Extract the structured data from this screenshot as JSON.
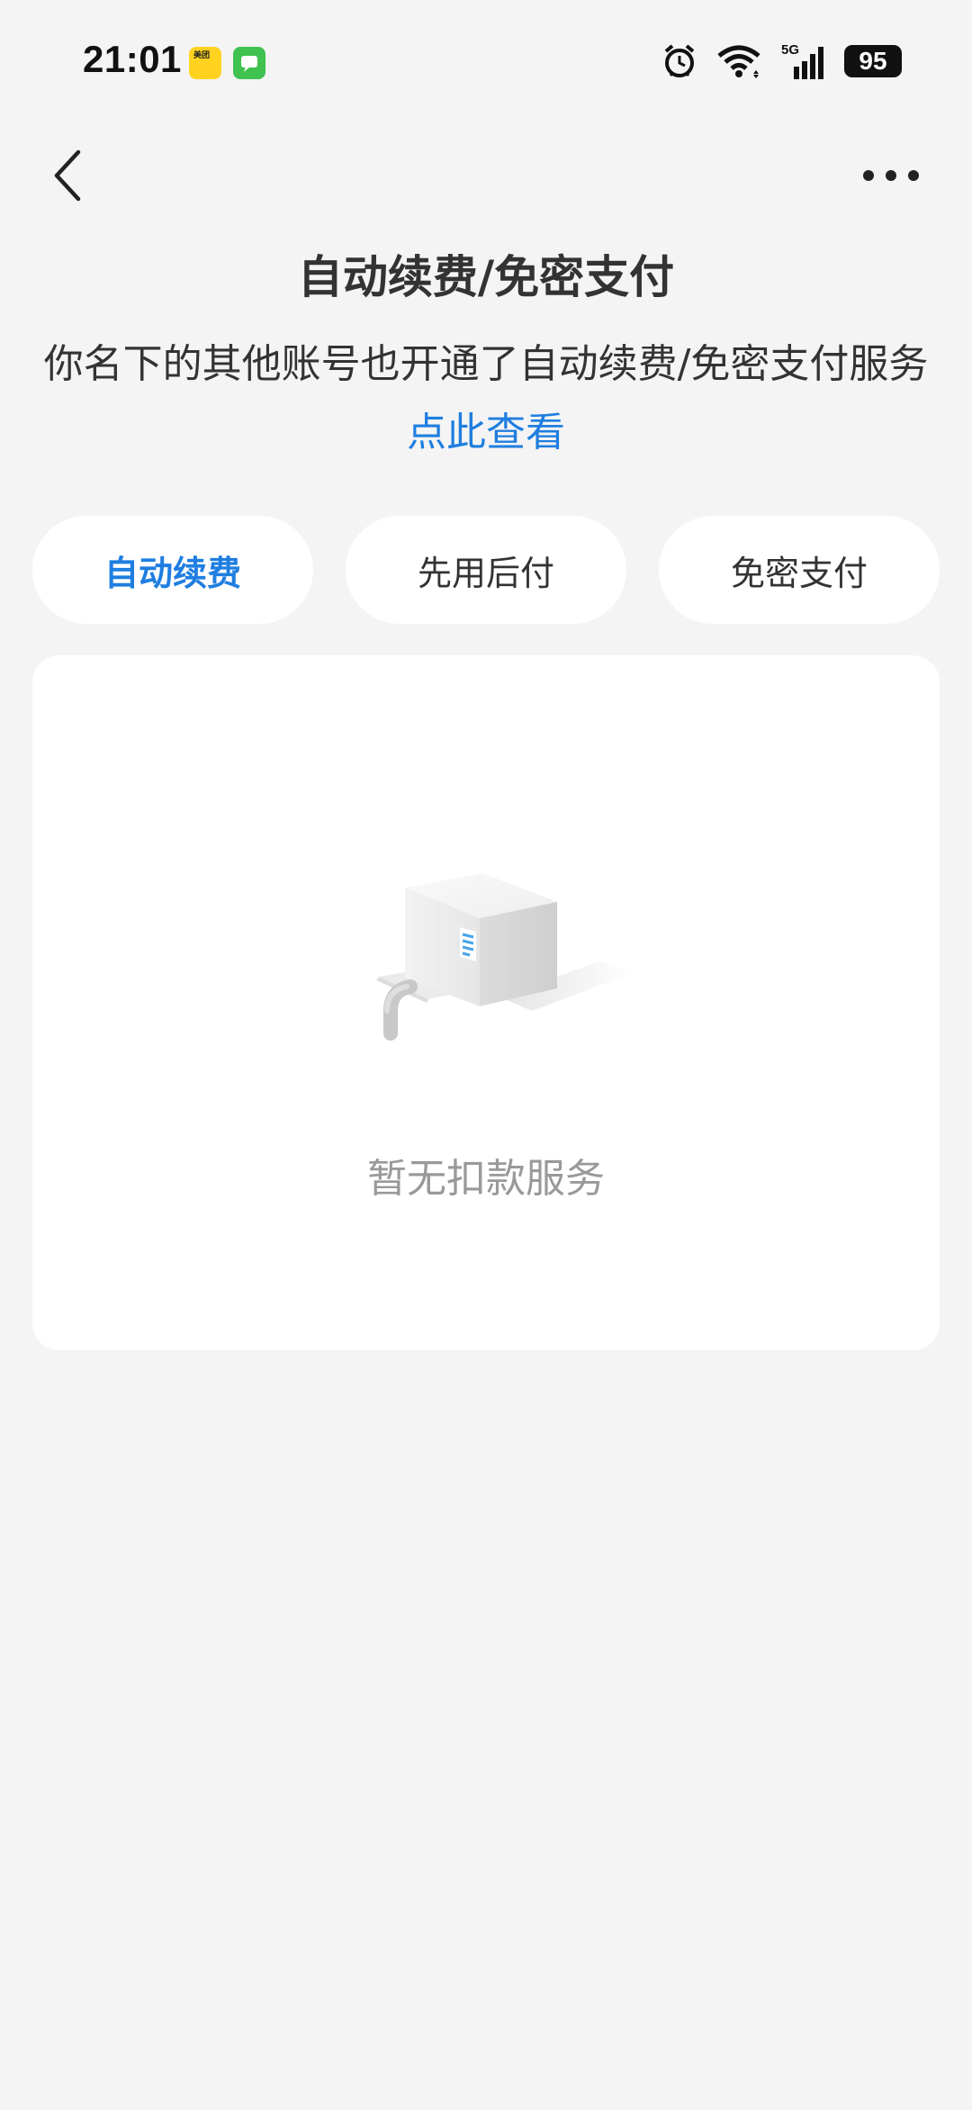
{
  "status_bar": {
    "time": "21:01",
    "meituan_icon_text": "美团",
    "network": "5G",
    "battery": "95"
  },
  "nav": {
    "back_icon": "chevron-left-icon",
    "more_icon": "more-dots-icon"
  },
  "page": {
    "title": "自动续费/免密支付",
    "notice": "你名下的其他账号也开通了自动续费/免密支付服务",
    "notice_link": "点此查看"
  },
  "tabs": [
    {
      "label": "自动续费",
      "active": true
    },
    {
      "label": "先用后付",
      "active": false
    },
    {
      "label": "免密支付",
      "active": false
    }
  ],
  "empty_state": {
    "icon": "empty-box-icon",
    "text": "暂无扣款服务"
  },
  "colors": {
    "accent": "#1f7ee0",
    "background": "#f4f4f4",
    "card": "#ffffff",
    "muted_text": "#999999"
  }
}
